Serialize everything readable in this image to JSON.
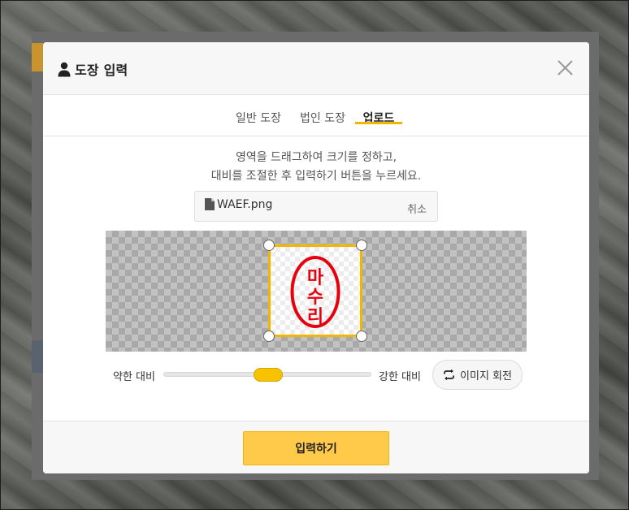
{
  "modal": {
    "title": "도장 입력",
    "title_icon": "user-icon",
    "close_icon": "close-icon"
  },
  "tabs": [
    {
      "label": "일반 도장",
      "active": false
    },
    {
      "label": "법인 도장",
      "active": false
    },
    {
      "label": "업로드",
      "active": true
    }
  ],
  "instructions": {
    "line1": "영역을 드래그하여 크기를 정하고,",
    "line2": "대비를 조절한 후 입력하기 버튼을 누르세요."
  },
  "file": {
    "icon": "file-icon",
    "name": "WAEF.png",
    "cancel_label": "취소"
  },
  "stamp_preview": {
    "chars": [
      "마",
      "수",
      "리"
    ],
    "color": "#e8000f"
  },
  "contrast": {
    "weak_label": "약한 대비",
    "strong_label": "강한 대비",
    "value_fraction": 0.5
  },
  "rotate": {
    "icon": "rotate-icon",
    "label": "이미지 회전"
  },
  "footer": {
    "submit_label": "입력하기"
  },
  "colors": {
    "accent": "#f2b600",
    "button": "#ffc94a"
  }
}
